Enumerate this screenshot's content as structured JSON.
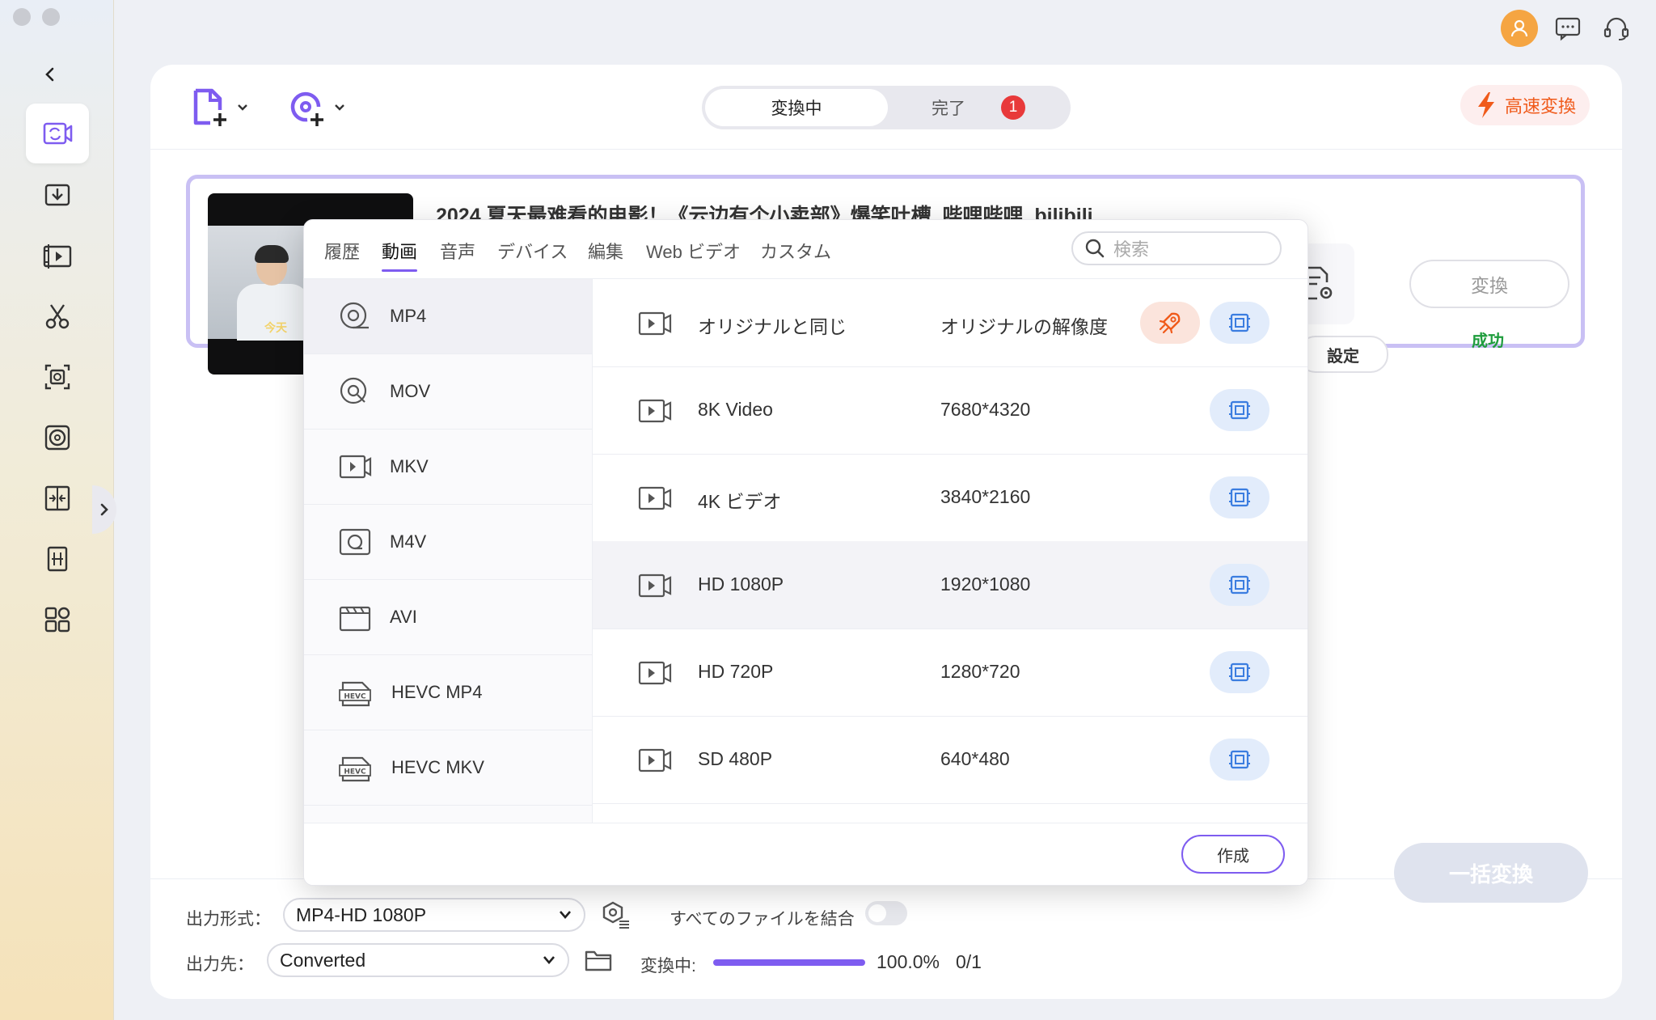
{
  "header": {
    "segment_active": "変換中",
    "segment_done": "完了",
    "done_badge": "1",
    "speed_label": "高速変換"
  },
  "task": {
    "title": "2024 夏天最难看的电影！《云边有个小卖部》爆笑吐槽_哔哩哔哩_bilibili",
    "thumb_overlay": "今天",
    "settings_label": "設定",
    "convert_label": "変換",
    "status": "成功"
  },
  "dialog": {
    "tabs": [
      "履歴",
      "動画",
      "音声",
      "デバイス",
      "編集",
      "Web ビデオ",
      "カスタム"
    ],
    "active_tab": "動画",
    "search_placeholder": "検索",
    "formats": [
      "MP4",
      "MOV",
      "MKV",
      "M4V",
      "AVI",
      "HEVC MP4",
      "HEVC MKV"
    ],
    "active_format": "MP4",
    "resolutions": [
      {
        "name": "オリジナルと同じ",
        "size": "オリジナルの解像度"
      },
      {
        "name": "8K Video",
        "size": "7680*4320"
      },
      {
        "name": "4K ビデオ",
        "size": "3840*2160"
      },
      {
        "name": "HD 1080P",
        "size": "1920*1080"
      },
      {
        "name": "HD 720P",
        "size": "1280*720"
      },
      {
        "name": "SD 480P",
        "size": "640*480"
      }
    ],
    "active_resolution": "HD 1080P",
    "create_label": "作成"
  },
  "bottom": {
    "output_format_label": "出力形式：",
    "output_format_value": "MP4-HD 1080P",
    "merge_label": "すべてのファイルを結合",
    "output_dest_label": "出力先：",
    "output_dest_value": "Converted",
    "converting_label": "変換中:",
    "progress_percent": "100.0%",
    "progress_count": "0/1",
    "progress_fraction": 1.0,
    "batch_label": "一括変換"
  },
  "colors": {
    "accent": "#7e5cf0",
    "success": "#1f9d3d",
    "speed": "#f05a1a"
  }
}
